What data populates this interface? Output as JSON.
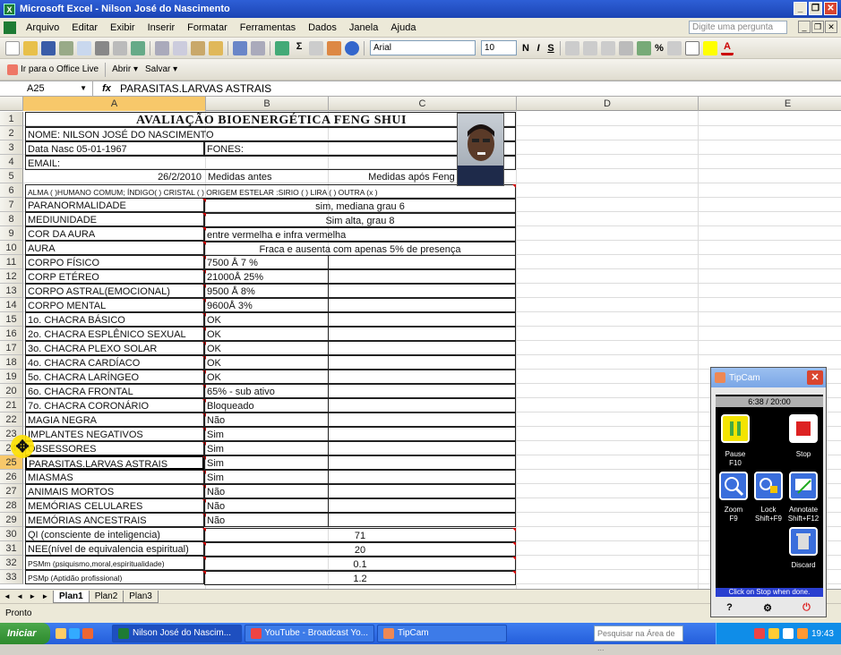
{
  "window": {
    "title": "Microsoft Excel - Nilson José do Nascimento"
  },
  "menu": {
    "items": [
      "Arquivo",
      "Editar",
      "Exibir",
      "Inserir",
      "Formatar",
      "Ferramentas",
      "Dados",
      "Janela",
      "Ajuda"
    ],
    "help_placeholder": "Digite uma pergunta"
  },
  "toolbar": {
    "font": "Arial",
    "size": "10",
    "zoom_sym": "%"
  },
  "toolbar2": {
    "officelive": "Ir para o Office Live",
    "abrir": "Abrir ▾",
    "salvar": "Salvar ▾"
  },
  "formula": {
    "namebox": "A25",
    "fx": "fx",
    "content": "PARASITAS.LARVAS ASTRAIS"
  },
  "columns": [
    "A",
    "B",
    "C",
    "D",
    "E"
  ],
  "rows": [
    "1",
    "2",
    "3",
    "4",
    "5",
    "6",
    "7",
    "8",
    "9",
    "10",
    "11",
    "12",
    "13",
    "14",
    "15",
    "16",
    "17",
    "18",
    "19",
    "20",
    "21",
    "22",
    "23",
    "24",
    "25",
    "26",
    "27",
    "28",
    "29",
    "30",
    "31",
    "32",
    "33"
  ],
  "sheet": {
    "title": "AVALIAÇÃO BIOENERGÉTICA FENG SHUI",
    "r2": "NOME: NILSON JOSÉ DO NASCIMENTO",
    "r3a": "Data Nasc 05-01-1967",
    "r3b": "FONES:",
    "r4": "EMAIL:",
    "r5a": "26/2/2010",
    "r5b": "Medidas antes",
    "r5c": "Medidas após Feng Shui",
    "r6": "ALMA (  )HUMANO COMUM; ÍNDIGO(  ) CRISTAL (    ) ORIGEM ESTELAR :SIRIO (  ) LIRA (  ) OUTRA (x  )",
    "labels": [
      "PARANORMALIDADE",
      "MEDIUNIDADE",
      "COR DA AURA",
      "AURA",
      "CORPO FÍSICO",
      "CORP ETÉREO",
      "CORPO ASTRAL(EMOCIONAL)",
      "CORPO MENTAL",
      "1o. CHACRA  BÁSICO",
      "2o. CHACRA  ESPLÊNICO SEXUAL",
      "3o. CHACRA PLEXO SOLAR",
      "4o. CHACRA CARDÍACO",
      "5o. CHACRA LARÍNGEO",
      "6o. CHACRA FRONTAL",
      "7o. CHACRA CORONÁRIO",
      "MAGIA NEGRA",
      "IMPLANTES NEGATIVOS",
      "OBSESSORES",
      "PARASITAS.LARVAS ASTRAIS",
      "MIASMAS",
      "ANIMAIS MORTOS",
      "MEMÓRIAS CELULARES",
      "MEMÓRIAS ANCESTRAIS",
      "QI (consciente de inteligencia)",
      "NEE(nível de equivalencia espiritual)",
      "PSMm (psiquismo,moral,espiritualidade)",
      "PSMp (Aptidão profissional)"
    ],
    "merged": {
      "r7": "sim, mediana grau 6",
      "r8": "Sim alta, grau 8",
      "r9": "entre vermelha e infra vermelha",
      "r10": "Fraca e ausenta com apenas 5% de presença"
    },
    "bvals": [
      "7500 Å 7 %",
      "21000Å 25%",
      "9500 Å 8%",
      "9600Å 3%",
      "OK",
      "OK",
      "OK",
      "OK",
      "OK",
      "65% - sub ativo",
      "Bloqueado",
      "Não",
      "Sim",
      "Sim",
      "Sim",
      "Sim",
      "Não",
      "Não",
      "Não"
    ],
    "r30": "71",
    "r31": "20",
    "r32": "0.1",
    "r33": "1.2"
  },
  "tabs": [
    "Plan1",
    "Plan2",
    "Plan3"
  ],
  "status": "Pronto",
  "taskbar": {
    "start": "Iniciar",
    "tasks": [
      "Nilson José do Nascim...",
      "YouTube - Broadcast Yo...",
      "TipCam"
    ],
    "search": "Pesquisar na Área de ...",
    "clock": "19:43"
  },
  "tipcam": {
    "title": "TipCam",
    "timer": "6:38 / 20:00",
    "pause": "Pause",
    "pause_key": "F10",
    "stop": "Stop",
    "zoom": "Zoom",
    "zoom_key": "F9",
    "lock": "Lock",
    "lock_key": "Shift+F9",
    "annotate": "Annotate",
    "annotate_key": "Shift+F12",
    "discard": "Discard",
    "hint": "Click on Stop when done.",
    "help": "?"
  },
  "colors": {
    "titlebar": "#1b44b4",
    "excel_green": "#1e7b34",
    "selection": "#f7c86a",
    "comment_mark": "#cc0000",
    "tipcam_red": "#d9452f"
  }
}
